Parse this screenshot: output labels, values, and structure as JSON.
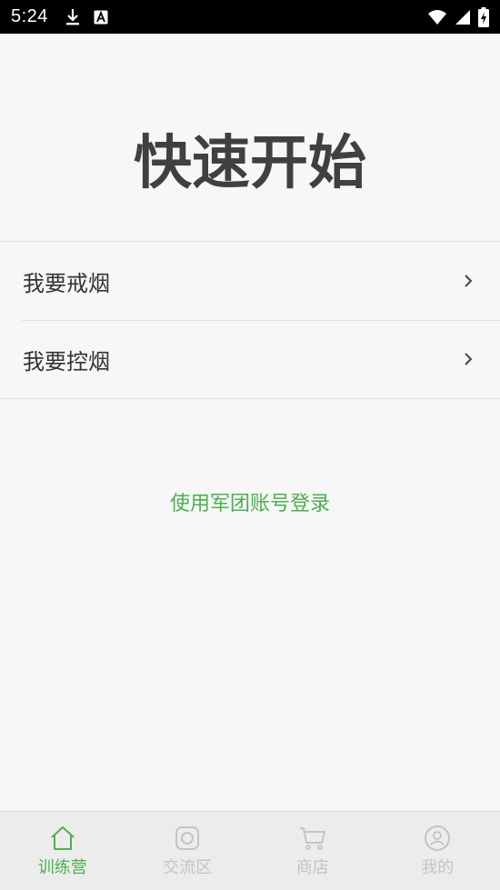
{
  "status_bar": {
    "time": "5:24",
    "icons": [
      "download-icon",
      "font-a-icon",
      "wifi-icon",
      "signal-icon",
      "battery-charging-icon"
    ]
  },
  "page": {
    "title": "快速开始"
  },
  "menu": {
    "items": [
      {
        "label": "我要戒烟",
        "icon": "chevron-right-icon"
      },
      {
        "label": "我要控烟",
        "icon": "chevron-right-icon"
      }
    ]
  },
  "login": {
    "label": "使用军团账号登录"
  },
  "bottom_nav": {
    "items": [
      {
        "label": "训练营",
        "icon": "home-icon",
        "active": true
      },
      {
        "label": "交流区",
        "icon": "camera-icon",
        "active": false
      },
      {
        "label": "商店",
        "icon": "cart-icon",
        "active": false
      },
      {
        "label": "我的",
        "icon": "profile-icon",
        "active": false
      }
    ]
  },
  "colors": {
    "accent": "#4caf50",
    "inactive": "#c4c4c4",
    "background": "#f7f7f7",
    "status_bar": "#000000"
  }
}
